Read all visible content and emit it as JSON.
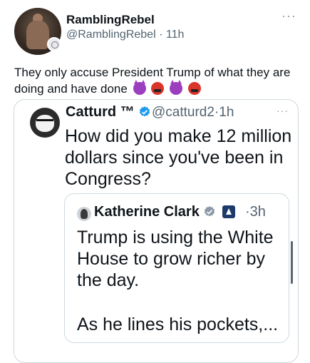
{
  "post": {
    "display_name": "RamblingRebel",
    "handle": "@RamblingRebel",
    "separator": "·",
    "time": "11h",
    "more": "···",
    "text": "They only accuse President Trump of what they are doing and have done",
    "emojis": [
      "smiling-devil",
      "cursing-face",
      "smiling-devil",
      "cursing-face"
    ]
  },
  "quote": {
    "display_name": "Catturd ™",
    "handle": "@catturd2",
    "separator": "·",
    "time": "1h",
    "more": "···",
    "text": "How did you make 12 million dollars since you've been in Congress?",
    "nested": {
      "display_name": "Katherine Clark",
      "separator": "·",
      "time": "3h",
      "text_line1": "Trump is using the White House to grow richer by the day.",
      "text_line2": "As he lines his pockets,..."
    }
  },
  "colors": {
    "verified_blue": "#1d9bf0",
    "gov_badge": "#1d3b6a",
    "secondary_text": "#536471",
    "border": "#cfd9de"
  }
}
